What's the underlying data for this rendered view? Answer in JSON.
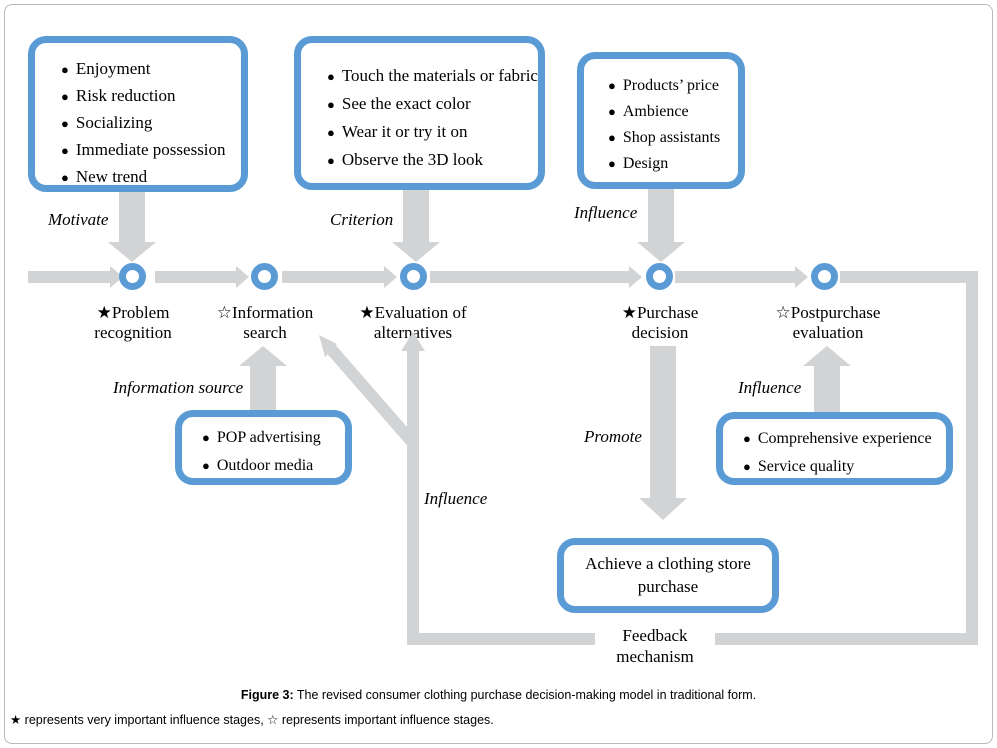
{
  "figure": {
    "caption_label": "Figure 3:",
    "caption_text": " The revised consumer clothing purchase decision-making model in traditional form.",
    "legend": "★ represents very important influence stages, ☆ represents important influence stages."
  },
  "colors": {
    "accent_blue": "#5b9bd5",
    "connector_gray": "#d2d3d5",
    "frame_gray": "#b9b9b9",
    "text_black": "#000000",
    "background": "#ffffff"
  },
  "stages": [
    {
      "star": "★",
      "line1": "Problem",
      "line2": "recognition",
      "importance": "very important"
    },
    {
      "star": "☆",
      "line1": "Information",
      "line2": "search",
      "importance": "important"
    },
    {
      "star": "★",
      "line1": "Evaluation of",
      "line2": "alternatives",
      "importance": "very important"
    },
    {
      "star": "★",
      "line1": "Purchase",
      "line2": "decision",
      "importance": "very important"
    },
    {
      "star": "☆",
      "line1": "Postpurchase",
      "line2": "evaluation",
      "importance": "important"
    }
  ],
  "top_boxes": [
    {
      "relation": "Motivate",
      "items": [
        "Enjoyment",
        "Risk reduction",
        "Socializing",
        "Immediate possession",
        "New trend"
      ]
    },
    {
      "relation": "Criterion",
      "items": [
        "Touch the materials or fabric",
        "See the exact color",
        "Wear it or try it on",
        "Observe the 3D look"
      ]
    },
    {
      "relation": "Influence",
      "items": [
        "Products’ price",
        "Ambience",
        "Shop assistants",
        "Design"
      ]
    }
  ],
  "bottom_boxes": [
    {
      "relation": "Information source",
      "items": [
        "POP advertising",
        "Outdoor media"
      ]
    },
    {
      "relation": "Influence",
      "items": [
        "Comprehensive experience",
        "Service quality"
      ]
    }
  ],
  "outcome": {
    "relation": "Promote",
    "line1": "Achieve a clothing store",
    "line2": "purchase"
  },
  "feedback": {
    "relation": "Influence",
    "line1": "Feedback",
    "line2": "mechanism"
  },
  "bullet_glyph": "●"
}
